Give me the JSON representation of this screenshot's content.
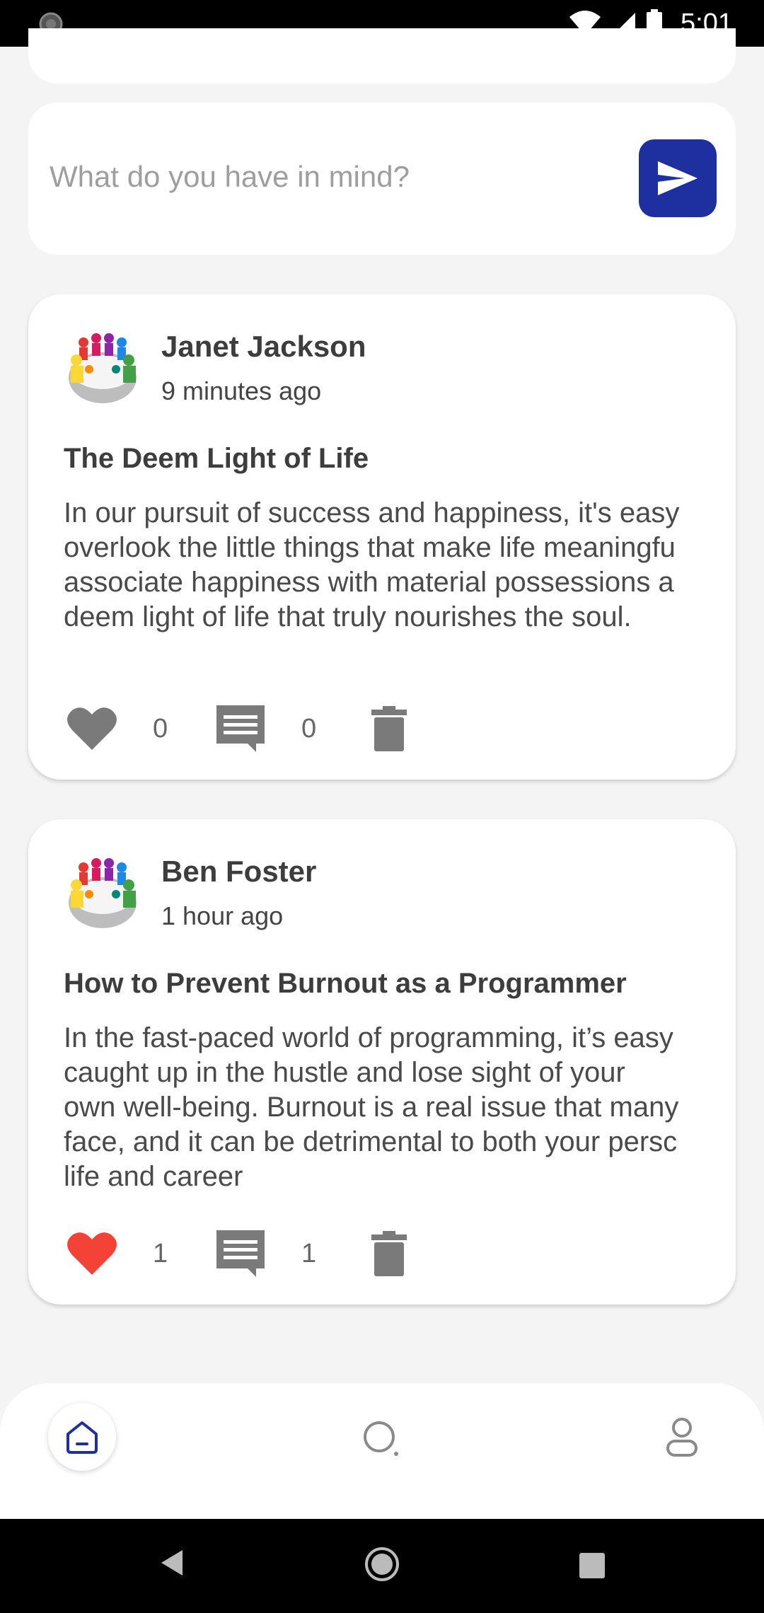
{
  "status_bar": {
    "time": "5:01"
  },
  "compose": {
    "placeholder": "What do you have in mind?"
  },
  "posts": [
    {
      "author": "Janet Jackson",
      "time": "9 minutes ago",
      "title": "The Deem Light of Life",
      "body_lines": [
        "In our pursuit of success and happiness, it's easy",
        "overlook the little things that make life meaningfu",
        "associate happiness with material possessions a",
        "deem light of life that truly nourishes the soul."
      ],
      "likes": "0",
      "comments": "0",
      "liked": false
    },
    {
      "author": "Ben Foster",
      "time": "1 hour ago",
      "title": "How to Prevent Burnout as a Programmer",
      "body_lines": [
        "In the fast-paced world of programming, it’s easy",
        "caught up in the hustle and lose sight of your",
        "own well-being. Burnout is a real issue that many",
        "face, and it can be detrimental to both your persc",
        "life and career"
      ],
      "likes": "1",
      "comments": "1",
      "liked": true
    }
  ],
  "colors": {
    "accent": "#1e2fa0",
    "liked": "#f44336",
    "icon_gray": "#7a7a7a"
  },
  "bottom_nav": [
    "home-icon",
    "search-icon",
    "profile-icon"
  ]
}
